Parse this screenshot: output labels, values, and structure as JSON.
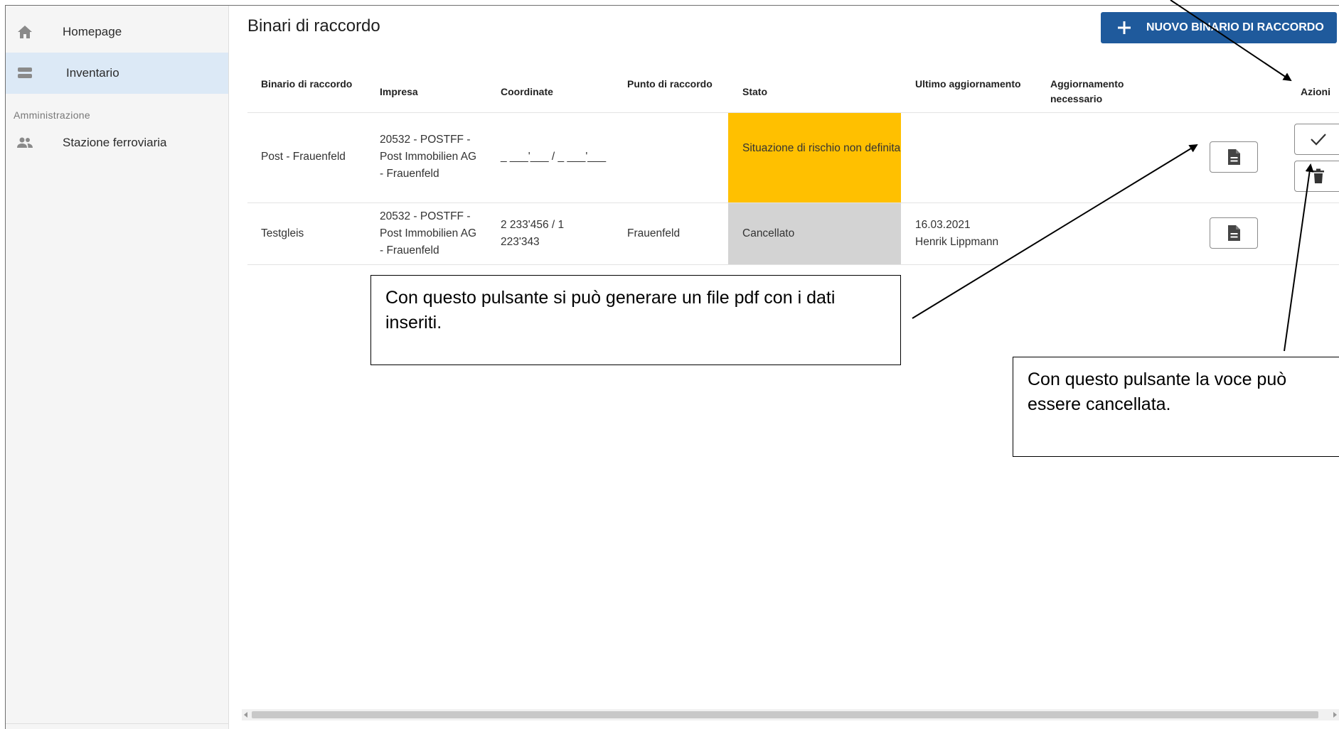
{
  "sidebar": {
    "items": [
      {
        "label": "Homepage",
        "icon": "home-icon"
      },
      {
        "label": "Inventario",
        "icon": "storage-icon",
        "active": true
      }
    ],
    "section_label": "Amministrazione",
    "admin_items": [
      {
        "label": "Stazione ferroviaria",
        "icon": "people-icon"
      }
    ]
  },
  "main": {
    "title": "Binari di raccordo",
    "new_button_label": "NUOVO BINARIO DI RACCORDO"
  },
  "table": {
    "headers": [
      "Binario di raccordo",
      "Impresa",
      "Coordinate",
      "Punto di raccordo",
      "Stato",
      "Ultimo aggiornamento",
      "Aggiornamento necessario",
      "Azioni"
    ],
    "rows": [
      {
        "binario": "Post - Frauenfeld",
        "impresa": "20532 - POSTFF - Post Immobilien AG - Frauenfeld",
        "coordinate": "_ ___'___ / _ ___'___",
        "punto": "",
        "stato": "Situazione di rischio non definita",
        "stato_color": "#ffc000",
        "ultimo_data": "",
        "ultimo_utente": ""
      },
      {
        "binario": "Testgleis",
        "impresa": "20532 - POSTFF - Post Immobilien AG - Frauenfeld",
        "coordinate": "2 233'456 / 1 223'343",
        "punto": "Frauenfeld",
        "stato": "Cancellato",
        "stato_color": "#d3d3d3",
        "ultimo_data": "16.03.2021",
        "ultimo_utente": "Henrik Lippmann"
      }
    ]
  },
  "callouts": {
    "pdf": "Con questo pulsante si può generare un file pdf con i dati inseriti.",
    "delete": "Con questo pulsante la voce può essere cancellata."
  },
  "colors": {
    "primary": "#1f5a9c",
    "active_nav": "#dce9f6",
    "status_risk": "#ffc000",
    "status_cancelled": "#d3d3d3"
  }
}
